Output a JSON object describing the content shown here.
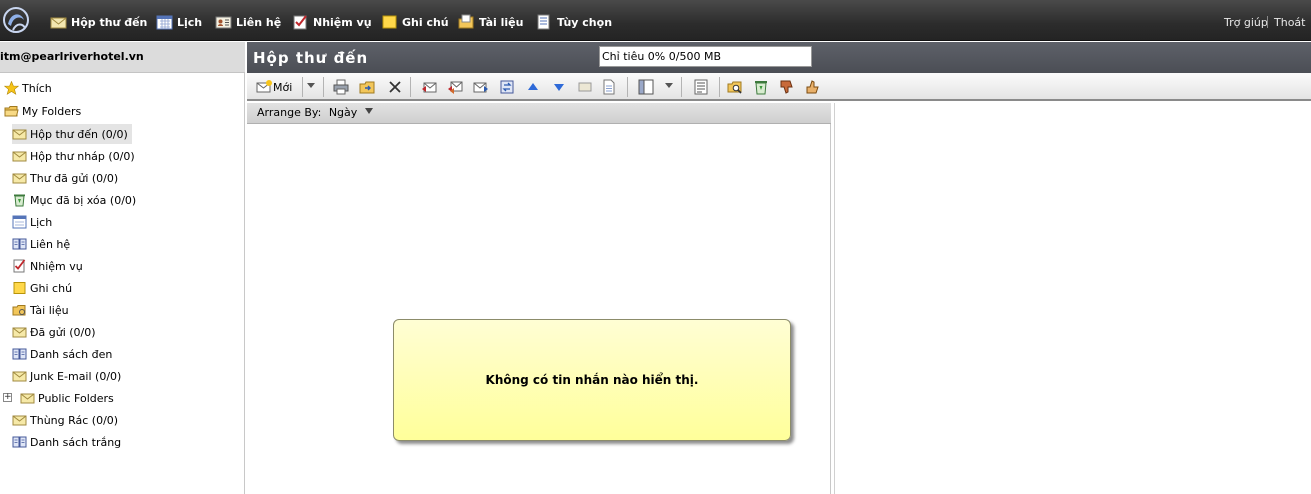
{
  "nav": {
    "items": [
      {
        "label": "Hộp thư đến",
        "icon": "inbox-icon"
      },
      {
        "label": "Lịch",
        "icon": "calendar-icon"
      },
      {
        "label": "Liên hệ",
        "icon": "contacts-icon"
      },
      {
        "label": "Nhiệm vụ",
        "icon": "tasks-icon"
      },
      {
        "label": "Ghi chú",
        "icon": "notes-icon"
      },
      {
        "label": "Tài liệu",
        "icon": "documents-icon"
      },
      {
        "label": "Tùy chọn",
        "icon": "options-icon"
      }
    ],
    "help": "Trợ giúp",
    "logout": "Thoát"
  },
  "user": {
    "email": "itm@pearlriverhotel.vn"
  },
  "tree": [
    {
      "label": "Thích",
      "icon": "star-icon"
    },
    {
      "label": "My Folders",
      "icon": "folders-icon"
    },
    {
      "label": "Hộp thư đến (0/0)",
      "icon": "envelope-icon"
    },
    {
      "label": "Hộp thư nháp (0/0)",
      "icon": "envelope-icon"
    },
    {
      "label": "Thư đã gửi (0/0)",
      "icon": "envelope-icon"
    },
    {
      "label": "Mục đã bị xóa (0/0)",
      "icon": "recycle-bin-icon"
    },
    {
      "label": "Lịch",
      "icon": "calendar-icon"
    },
    {
      "label": "Liên hệ",
      "icon": "address-book-icon"
    },
    {
      "label": "Nhiệm vụ",
      "icon": "tasks-icon"
    },
    {
      "label": "Ghi chú",
      "icon": "note-icon"
    },
    {
      "label": "Tài liệu",
      "icon": "documents-icon"
    },
    {
      "label": "Đã gửi (0/0)",
      "icon": "envelope-icon"
    },
    {
      "label": "Danh sách đen",
      "icon": "address-book-icon"
    },
    {
      "label": "Junk E-mail (0/0)",
      "icon": "envelope-icon"
    },
    {
      "label": "Public Folders",
      "icon": "envelope-icon"
    },
    {
      "label": "Thùng Rác (0/0)",
      "icon": "envelope-icon"
    },
    {
      "label": "Danh sách trắng",
      "icon": "address-book-icon"
    }
  ],
  "main": {
    "title": "Hộp thư đến",
    "quota": "Chỉ tiêu 0% 0/500 MB",
    "new_label": "Mới",
    "arrange_label": "Arrange By:",
    "arrange_value": "Ngày",
    "empty_message": "Không có tin nhắn nào hiển thị."
  },
  "colors": {
    "nav_bg": "#2c2c2c",
    "header_bg": "#53565d",
    "empty_bg": "#ffff9a"
  }
}
